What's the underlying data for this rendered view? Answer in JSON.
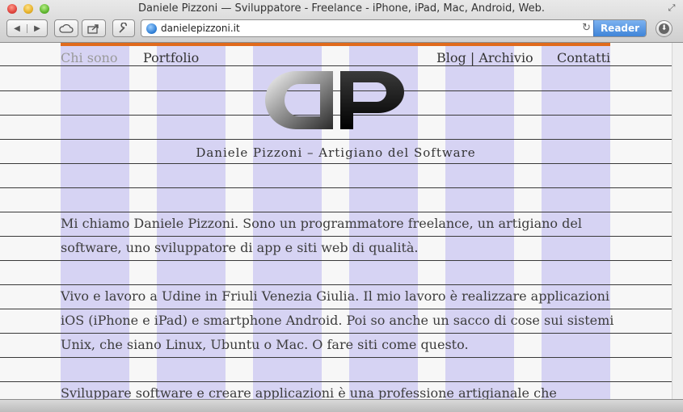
{
  "window": {
    "title": "Daniele Pizzoni — Sviluppatore - Freelance - iPhone, iPad, Mac, Android, Web."
  },
  "toolbar": {
    "back_icon": "back-arrow-icon",
    "forward_icon": "forward-arrow-icon",
    "url": "danielepizzoni.it",
    "reader_label": "Reader"
  },
  "site": {
    "accent_color": "#e06a1c",
    "column_color": "#d6d3f3",
    "nav": {
      "about": "Chi sono",
      "portfolio": "Portfolio",
      "blog_archive": "Blog | Archivio",
      "contact": "Contatti"
    },
    "logo_text": "DP",
    "tagline": "Daniele Pizzoni – Artigiano del Software",
    "paragraphs": [
      "Mi chiamo Daniele Pizzoni. Sono un programmatore freelance, un artigiano del software, uno sviluppatore di app e siti web di qualità.",
      "Vivo e lavoro a Udine in Friuli Venezia Giulia. Il mio lavoro è realizzare applicazioni iOS (iPhone e iPad) e smartphone Android. Poi so anche un sacco di cose sui sistemi Unix, che siano Linux, Ubuntu o Mac. O fare siti come questo.",
      "Sviluppare software e creare applicazioni è una professione artigianale che"
    ]
  }
}
